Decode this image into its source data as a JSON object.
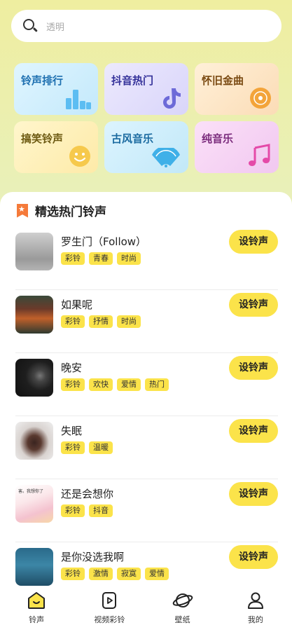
{
  "search": {
    "placeholder": "透明"
  },
  "categories": [
    {
      "label": "铃声排行",
      "icon": "bar-chart-icon",
      "bg": "#d4f0fb",
      "color": "#1976b8"
    },
    {
      "label": "抖音热门",
      "icon": "tiktok-icon",
      "bg": "#e6e3fb",
      "color": "#3a3aa0"
    },
    {
      "label": "怀旧金曲",
      "icon": "vinyl-record-icon",
      "bg": "#fde6c6",
      "color": "#7b4a10"
    },
    {
      "label": "搞笑铃声",
      "icon": "smiley-icon",
      "bg": "#fff0b8",
      "color": "#6b5a10"
    },
    {
      "label": "古风音乐",
      "icon": "fan-icon",
      "bg": "#cfeefb",
      "color": "#1a6fa6"
    },
    {
      "label": "纯音乐",
      "icon": "music-note-icon",
      "bg": "#f7d6f5",
      "color": "#7a2a7a"
    }
  ],
  "section": {
    "title": "精选热门铃声"
  },
  "songs": [
    {
      "name": "罗生门（Follow）",
      "tags": [
        "彩铃",
        "青春",
        "时尚"
      ],
      "button": "设铃声"
    },
    {
      "name": "如果呢",
      "tags": [
        "彩铃",
        "抒情",
        "时尚"
      ],
      "button": "设铃声"
    },
    {
      "name": "晚安",
      "tags": [
        "彩铃",
        "欢快",
        "爱情",
        "热门"
      ],
      "button": "设铃声"
    },
    {
      "name": "失眠",
      "tags": [
        "彩铃",
        "温暖"
      ],
      "button": "设铃声"
    },
    {
      "name": "还是会想你",
      "tags": [
        "彩铃",
        "抖音"
      ],
      "button": "设铃声"
    },
    {
      "name": "是你没选我啊",
      "tags": [
        "彩铃",
        "激情",
        "寂寞",
        "爱情"
      ],
      "button": "设铃声"
    }
  ],
  "thumb_texts": {
    "song5": "害。我想你了"
  },
  "tabs": [
    {
      "label": "铃声",
      "icon": "bell-home-icon"
    },
    {
      "label": "视频彩铃",
      "icon": "video-icon"
    },
    {
      "label": "壁纸",
      "icon": "planet-icon"
    },
    {
      "label": "我的",
      "icon": "user-icon"
    }
  ],
  "colors": {
    "accent": "#fbe34a",
    "bookmark": "#f57a3a"
  }
}
